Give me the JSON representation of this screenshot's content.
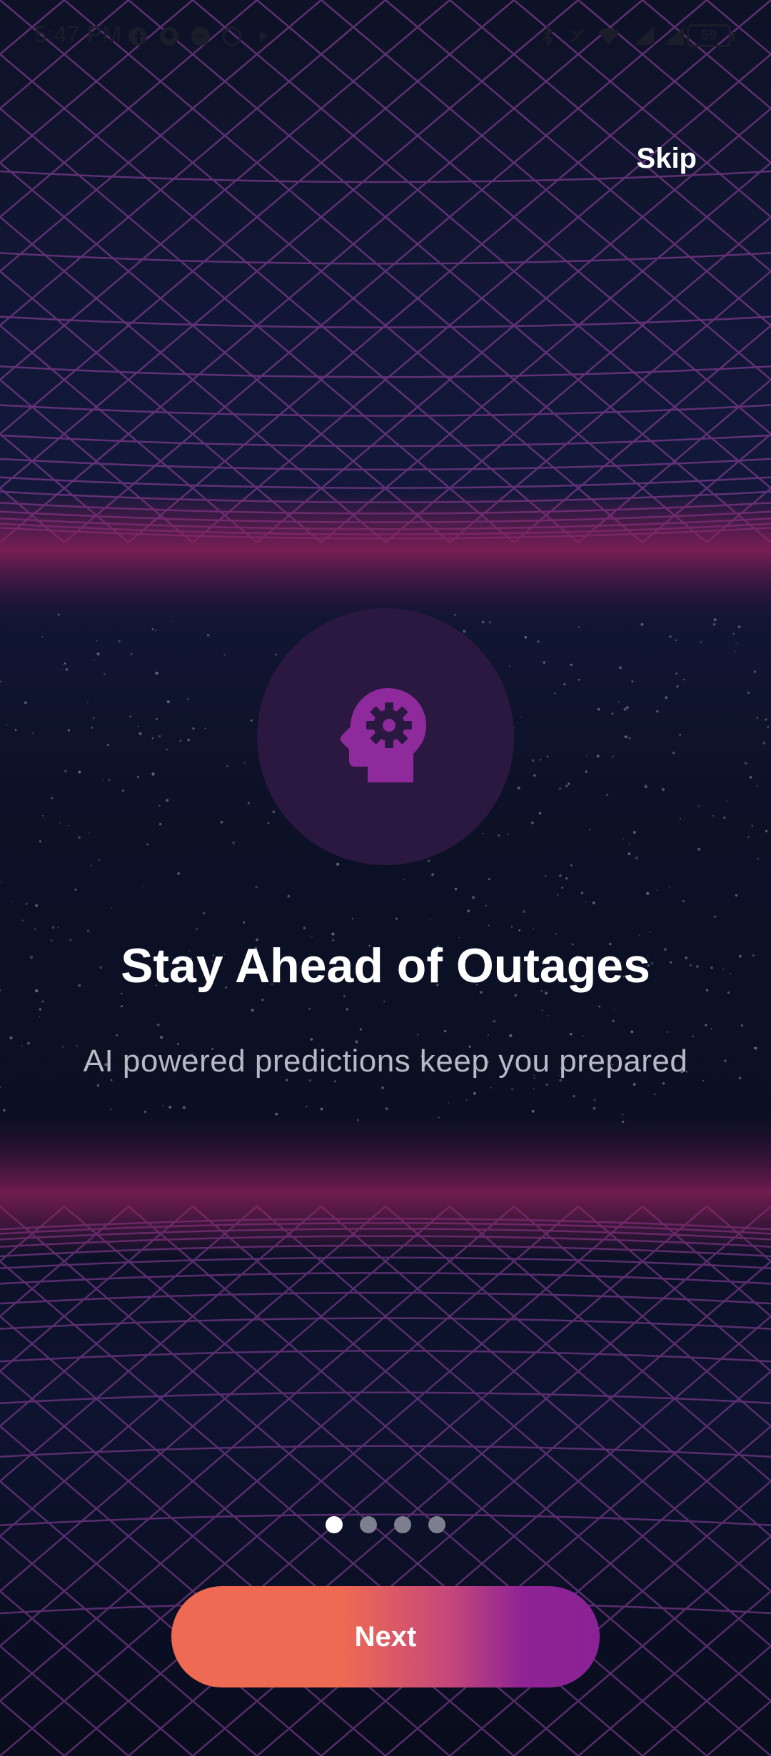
{
  "status_bar": {
    "time": "5:47 PM",
    "battery": "59",
    "left_icons": [
      "facebook-icon",
      "github-icon",
      "messenger-icon",
      "whatsapp-icon",
      "location-icon"
    ],
    "right_icons": [
      "bluetooth-icon",
      "nfc-icon",
      "wifi-icon",
      "signal-lte-icon",
      "signal-4g-icon",
      "battery-icon"
    ]
  },
  "onboarding": {
    "skip_label": "Skip",
    "hero_icon": "head-gear-icon",
    "title": "Stay Ahead of Outages",
    "subtitle": "AI powered predictions keep you prepared",
    "page_indicator": {
      "total": 4,
      "current": 1
    },
    "next_label": "Next"
  },
  "colors": {
    "background": "#0c1024",
    "grid_line": "#7a3a8a",
    "horizon_glow": "#8a1f5a",
    "hero_circle": "#2a1840",
    "hero_icon": "#8e2a9c",
    "button_start": "#ef6a53",
    "button_end": "#8a2295",
    "dot_active": "#ffffff",
    "dot_inactive": "#7d7f8e"
  }
}
